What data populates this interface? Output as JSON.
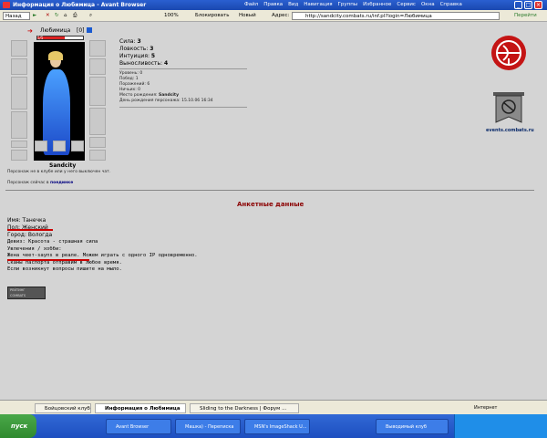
{
  "window": {
    "title": "Информация о Любимица - Avant Browser"
  },
  "menu": [
    "Файл",
    "Правка",
    "Вид",
    "Навигация",
    "Группы",
    "Избранное",
    "Сервис",
    "Окна",
    "Справка"
  ],
  "toolbar": {
    "back": "Назад",
    "zoom": "100%",
    "block": "Блокировать",
    "new": "Новый",
    "address_label": "Адрес:",
    "url": "http://sandcity.combats.ru/inf.pl?login=Любимица",
    "go": "Перейти"
  },
  "character": {
    "name": "Любимица",
    "level": "[0]",
    "hp": "5/5",
    "city": "Sandcity",
    "status_line": "Персонаж не в клубе или у него выключен чат.",
    "location_prefix": "Персонаж сейчас в",
    "location": "поединке",
    "stats": [
      {
        "label": "Сила:",
        "value": "3"
      },
      {
        "label": "Ловкость:",
        "value": "3"
      },
      {
        "label": "Интуиция:",
        "value": "5"
      },
      {
        "label": "Выносливость:",
        "value": "4"
      }
    ],
    "info": [
      {
        "label": "Уровень:",
        "value": "0"
      },
      {
        "label": "Побед:",
        "value": "1"
      },
      {
        "label": "Поражений:",
        "value": "6"
      },
      {
        "label": "Ничьих:",
        "value": "0"
      },
      {
        "label": "Место рождения:",
        "value": "Sandcity"
      },
      {
        "label": "День рождения персонажа:",
        "value": "15.10.06 16:34"
      }
    ]
  },
  "events_link": "events.combats.ru",
  "profile": {
    "heading": "Анкетные данные",
    "lines": [
      "Имя: Танечка",
      "Пол: Женский",
      "Город: Вологда",
      "Девиз: Красота - страшная сила",
      "Увлечения / хобби:",
      "Жена чеет-sаупs в реале. Можем играть с одного IP одновременно.",
      "Сканы паспорта отправим в любое время.",
      "Если возникнут вопросы пишите на мыло."
    ]
  },
  "badge": {
    "line1": "РЕЙТИНГ",
    "line2": "COMBATS"
  },
  "tabs": [
    "Бойцовский клуб",
    "Информация о Любимица",
    "Sliding to the Darkness | Форум ..."
  ],
  "status": {
    "zone": "Интернет"
  },
  "taskbar": {
    "start": "пуск",
    "items": [
      "Avant Browser",
      "Машка) - Переписка",
      "MSN's ImageShack U...",
      "Выводимый клуб"
    ]
  },
  "colors": {
    "title_blue": "#1a48b0",
    "heading_red": "#8b0000",
    "underline_red": "#c00000",
    "taskbar": "#245edb"
  }
}
